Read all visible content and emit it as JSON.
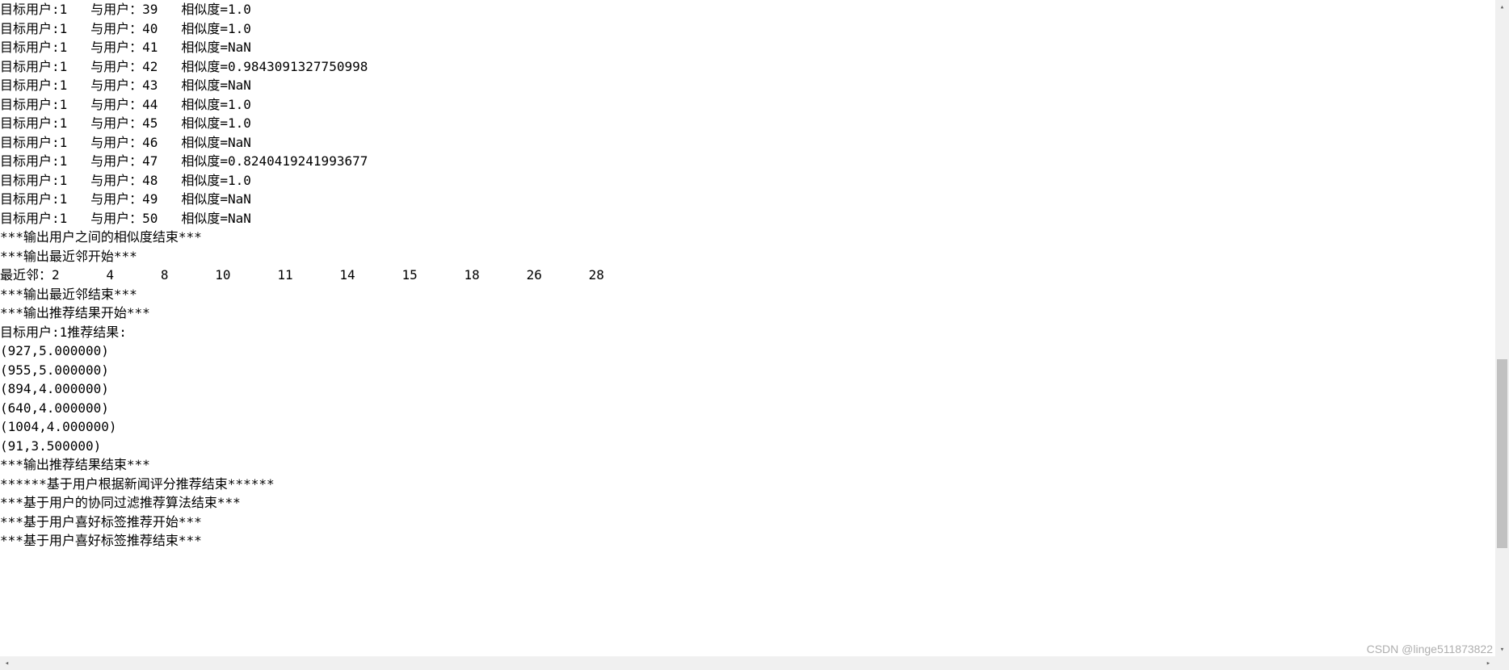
{
  "similarity_rows": [
    {
      "target_label": "目标用户:",
      "target_id": "1",
      "with_label": "与用户：",
      "with_id": "39",
      "sim_label": "相似度=",
      "sim_value": "1.0"
    },
    {
      "target_label": "目标用户:",
      "target_id": "1",
      "with_label": "与用户：",
      "with_id": "40",
      "sim_label": "相似度=",
      "sim_value": "1.0"
    },
    {
      "target_label": "目标用户:",
      "target_id": "1",
      "with_label": "与用户：",
      "with_id": "41",
      "sim_label": "相似度=",
      "sim_value": "NaN"
    },
    {
      "target_label": "目标用户:",
      "target_id": "1",
      "with_label": "与用户：",
      "with_id": "42",
      "sim_label": "相似度=",
      "sim_value": "0.9843091327750998"
    },
    {
      "target_label": "目标用户:",
      "target_id": "1",
      "with_label": "与用户：",
      "with_id": "43",
      "sim_label": "相似度=",
      "sim_value": "NaN"
    },
    {
      "target_label": "目标用户:",
      "target_id": "1",
      "with_label": "与用户：",
      "with_id": "44",
      "sim_label": "相似度=",
      "sim_value": "1.0"
    },
    {
      "target_label": "目标用户:",
      "target_id": "1",
      "with_label": "与用户：",
      "with_id": "45",
      "sim_label": "相似度=",
      "sim_value": "1.0"
    },
    {
      "target_label": "目标用户:",
      "target_id": "1",
      "with_label": "与用户：",
      "with_id": "46",
      "sim_label": "相似度=",
      "sim_value": "NaN"
    },
    {
      "target_label": "目标用户:",
      "target_id": "1",
      "with_label": "与用户：",
      "with_id": "47",
      "sim_label": "相似度=",
      "sim_value": "0.8240419241993677"
    },
    {
      "target_label": "目标用户:",
      "target_id": "1",
      "with_label": "与用户：",
      "with_id": "48",
      "sim_label": "相似度=",
      "sim_value": "1.0"
    },
    {
      "target_label": "目标用户:",
      "target_id": "1",
      "with_label": "与用户：",
      "with_id": "49",
      "sim_label": "相似度=",
      "sim_value": "NaN"
    },
    {
      "target_label": "目标用户:",
      "target_id": "1",
      "with_label": "与用户：",
      "with_id": "50",
      "sim_label": "相似度=",
      "sim_value": "NaN"
    }
  ],
  "section_lines": {
    "sim_end": "***输出用户之间的相似度结束***",
    "nn_start": "***输出最近邻开始***",
    "nn_label": "最近邻：",
    "nn_values": [
      "2",
      "4",
      "8",
      "10",
      "11",
      "14",
      "15",
      "18",
      "26",
      "28"
    ],
    "nn_end": "***输出最近邻结束***",
    "rec_start": "***输出推荐结果开始***",
    "rec_header": "目标用户:1推荐结果:",
    "rec_end": "***输出推荐结果结束***",
    "news_rating_end": "******基于用户根据新闻评分推荐结束******",
    "cf_end": "***基于用户的协同过滤推荐算法结束***",
    "tag_start": "***基于用户喜好标签推荐开始***",
    "tag_end": "***基于用户喜好标签推荐结束***"
  },
  "recommendations": [
    "(927,5.000000)",
    "(955,5.000000)",
    "(894,4.000000)",
    "(640,4.000000)",
    "(1004,4.000000)",
    "(91,3.500000)"
  ],
  "watermark": "CSDN @linge511873822"
}
